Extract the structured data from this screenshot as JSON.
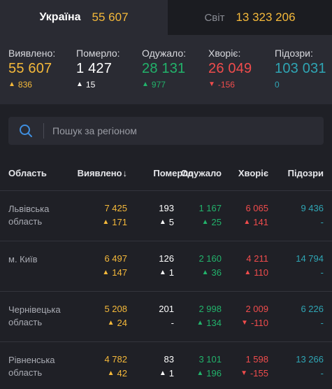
{
  "tabs": {
    "ukraine": {
      "label": "Україна",
      "value": "55 607"
    },
    "world": {
      "label": "Світ",
      "value": "13 323 206"
    }
  },
  "summary": {
    "confirmed": {
      "label": "Виявлено:",
      "value": "55 607",
      "delta": "836",
      "dir": "up"
    },
    "deaths": {
      "label": "Померло:",
      "value": "1 427",
      "delta": "15",
      "dir": "up"
    },
    "recovered": {
      "label": "Одужало:",
      "value": "28 131",
      "delta": "977",
      "dir": "up"
    },
    "sick": {
      "label": "Хворіє:",
      "value": "26 049",
      "delta": "-156",
      "dir": "down"
    },
    "suspect": {
      "label": "Підозри:",
      "value": "103 031",
      "delta": "0",
      "dir": "none"
    }
  },
  "search": {
    "placeholder": "Пошук за регіоном",
    "value": ""
  },
  "table": {
    "headers": {
      "region": "Область",
      "confirmed": "Виявлено",
      "confirmed_sort": "↓",
      "deaths": "Померло",
      "recovered": "Одужало",
      "sick": "Хворіє",
      "suspect": "Підозри"
    },
    "rows": [
      {
        "region": "Львівська область",
        "confirmed": "7 425",
        "confirmed_delta": "171",
        "confirmed_dir": "up",
        "deaths": "193",
        "deaths_delta": "5",
        "deaths_dir": "up",
        "recovered": "1 167",
        "recovered_delta": "25",
        "recovered_dir": "up",
        "sick": "6 065",
        "sick_delta": "141",
        "sick_dir": "up",
        "suspect": "9 436",
        "suspect_delta": "-",
        "suspect_dir": "none"
      },
      {
        "region": "м. Київ",
        "confirmed": "6 497",
        "confirmed_delta": "147",
        "confirmed_dir": "up",
        "deaths": "126",
        "deaths_delta": "1",
        "deaths_dir": "up",
        "recovered": "2 160",
        "recovered_delta": "36",
        "recovered_dir": "up",
        "sick": "4 211",
        "sick_delta": "110",
        "sick_dir": "up",
        "suspect": "14 794",
        "suspect_delta": "-",
        "suspect_dir": "none"
      },
      {
        "region": "Чернівецька область",
        "confirmed": "5 208",
        "confirmed_delta": "24",
        "confirmed_dir": "up",
        "deaths": "201",
        "deaths_delta": "-",
        "deaths_dir": "none",
        "recovered": "2 998",
        "recovered_delta": "134",
        "recovered_dir": "up",
        "sick": "2 009",
        "sick_delta": "-110",
        "sick_dir": "down",
        "suspect": "6 226",
        "suspect_delta": "-",
        "suspect_dir": "none"
      },
      {
        "region": "Рівненська область",
        "confirmed": "4 782",
        "confirmed_delta": "42",
        "confirmed_dir": "up",
        "deaths": "83",
        "deaths_delta": "1",
        "deaths_dir": "up",
        "recovered": "3 101",
        "recovered_delta": "196",
        "recovered_dir": "up",
        "sick": "1 598",
        "sick_delta": "-155",
        "sick_dir": "down",
        "suspect": "13 266",
        "suspect_delta": "-",
        "suspect_dir": "none"
      }
    ]
  },
  "colors": {
    "confirmed": "#f5b93a",
    "deaths": "#ffffff",
    "recovered": "#22b36b",
    "sick": "#f04c4c",
    "suspect": "#2fa5b4",
    "search_icon": "#3f8fe0"
  },
  "icons": {
    "search": "search-icon",
    "up": "arrow-up-icon",
    "down": "arrow-down-icon"
  }
}
